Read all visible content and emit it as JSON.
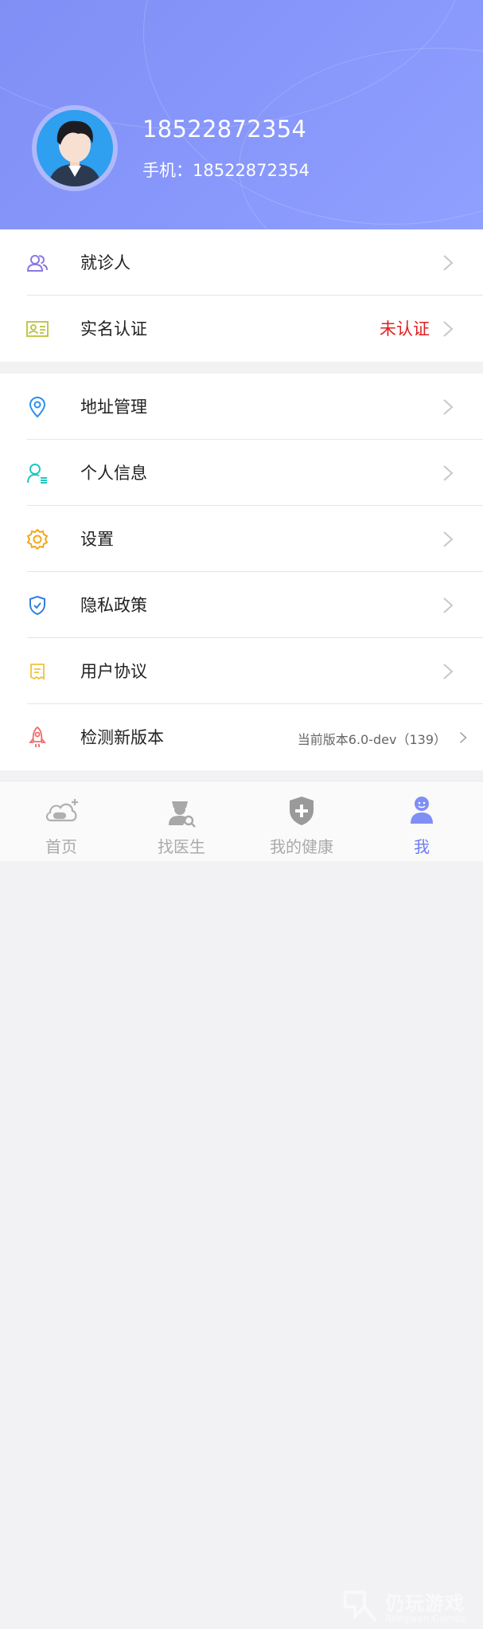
{
  "profile": {
    "name": "18522872354",
    "phone_line": "手机：18522872354"
  },
  "menu_group1": [
    {
      "label": "就诊人",
      "icon": "patients-icon",
      "value": ""
    },
    {
      "label": "实名认证",
      "icon": "id-card-icon",
      "value": "未认证"
    }
  ],
  "menu_group2": [
    {
      "label": "地址管理",
      "icon": "location-pin-icon",
      "value": ""
    },
    {
      "label": "个人信息",
      "icon": "person-info-icon",
      "value": ""
    },
    {
      "label": "设置",
      "icon": "gear-icon",
      "value": ""
    },
    {
      "label": "隐私政策",
      "icon": "shield-check-icon",
      "value": ""
    },
    {
      "label": "用户协议",
      "icon": "document-icon",
      "value": ""
    },
    {
      "label": "检测新版本",
      "icon": "rocket-icon",
      "value": "当前版本6.0-dev（139）"
    }
  ],
  "tabs": [
    {
      "label": "首页",
      "icon": "cloud-home-icon",
      "active": false
    },
    {
      "label": "找医生",
      "icon": "doctor-search-icon",
      "active": false
    },
    {
      "label": "我的健康",
      "icon": "health-shield-icon",
      "active": false
    },
    {
      "label": "我",
      "icon": "me-icon",
      "active": true
    }
  ],
  "colors": {
    "header": "#8998fb",
    "accent": "#6c7cf5",
    "warning_text": "#e02020"
  },
  "watermark": {
    "title": "仍玩游戏",
    "subtitle": "Rengwan Games"
  }
}
